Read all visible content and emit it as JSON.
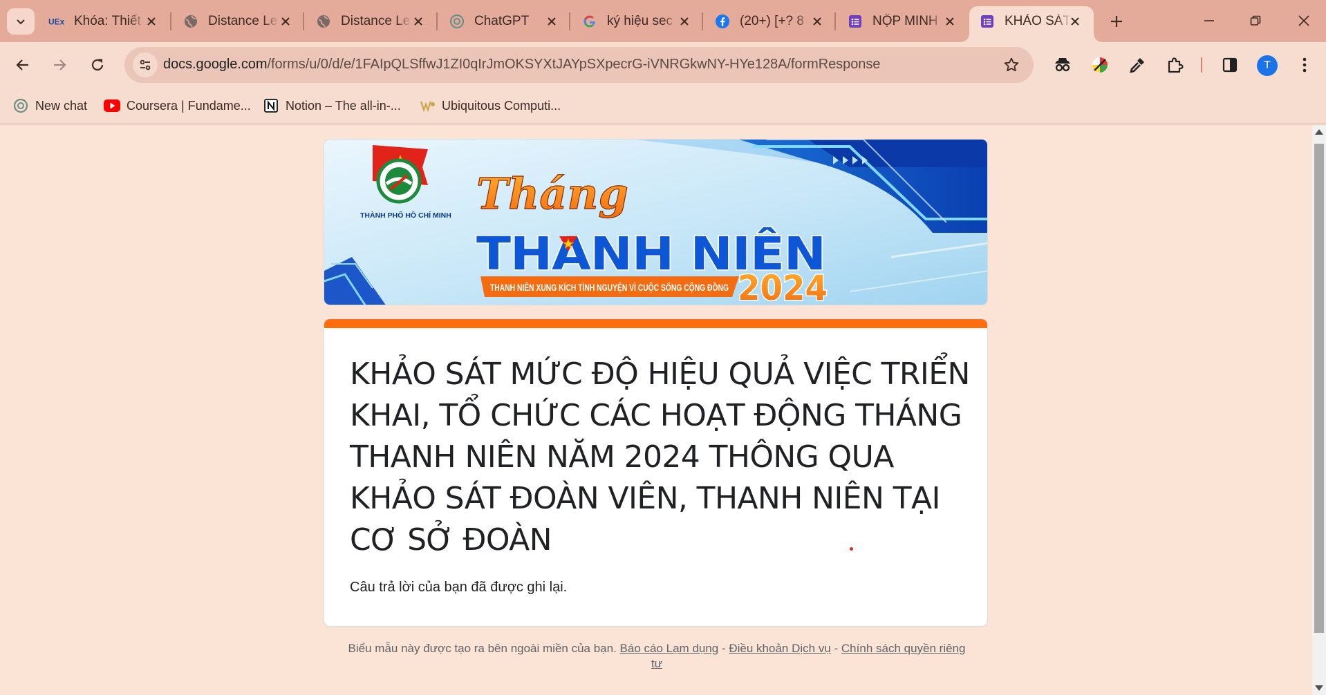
{
  "browser": {
    "tabs": [
      {
        "title": "Khóa: Thiết",
        "favicon": "uex-icon"
      },
      {
        "title": "Distance Le",
        "favicon": "globe-icon"
      },
      {
        "title": "Distance Le",
        "favicon": "globe-icon"
      },
      {
        "title": "ChatGPT",
        "favicon": "chatgpt-icon"
      },
      {
        "title": "ký hiệu sec",
        "favicon": "google-icon"
      },
      {
        "title": "(20+) [+? 8",
        "favicon": "facebook-icon"
      },
      {
        "title": "NỘP MINH",
        "favicon": "forms-icon"
      },
      {
        "title": "KHẢO SÁT",
        "favicon": "forms-icon",
        "active": true
      }
    ],
    "url_host": "docs.google.com",
    "url_path": "/forms/u/0/d/e/1FAIpQLSffwJ1ZI0qIrJmOKSYXtJAYpSXpecrG-iVNRGkwNY-HYe128A/formResponse",
    "profile_initial": "T",
    "bookmarks": [
      {
        "label": "New chat",
        "icon": "chatgpt-icon"
      },
      {
        "label": "Coursera | Fundame...",
        "icon": "youtube-icon"
      },
      {
        "label": "Notion – The all-in-...",
        "icon": "notion-icon"
      },
      {
        "label": "Ubiquitous Computi...",
        "icon": "ubiquitous-icon"
      }
    ]
  },
  "banner": {
    "logo_text": "THÀNH PHỐ HỒ CHÍ MINH",
    "headline_script": "Tháng",
    "headline_main": "THANH NIÊN",
    "tagline": "THANH NIÊN XUNG KÍCH TÌNH NGUYỆN VÌ CUỘC SỐNG CỘNG ĐỒNG",
    "year": "2024"
  },
  "form": {
    "title": "KHẢO SÁT MỨC ĐỘ HIỆU QUẢ VIỆC TRIỂN KHAI, TỔ CHỨC CÁC HOẠT ĐỘNG THÁNG THANH NIÊN NĂM 2024 THÔNG QUA KHẢO SÁT ĐOÀN VIÊN, THANH NIÊN TẠI CƠ SỞ ĐOÀN",
    "confirmation": "Câu trả lời của bạn đã được ghi lại."
  },
  "footer": {
    "text": "Biểu mẫu này được tạo ra bên ngoài miền của bạn.",
    "report_abuse": "Báo cáo Lạm dụng",
    "sep": " - ",
    "terms": "Điều khoản Dịch vụ",
    "privacy": "Chính sách quyền riêng tư"
  },
  "colors": {
    "accent": "#ff6d0f",
    "page_bg": "#fbe3d6",
    "tabstrip_bg": "#e4ab9b"
  }
}
